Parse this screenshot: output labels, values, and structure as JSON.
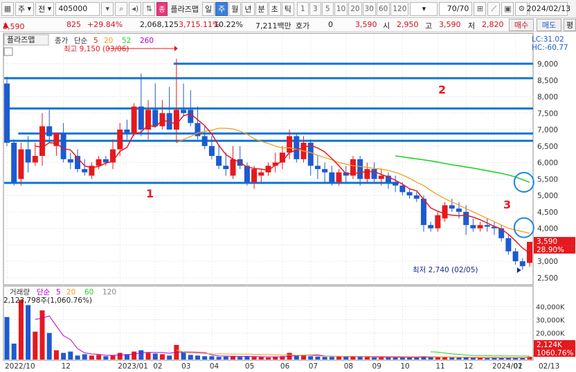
{
  "toolbar": {
    "market": "주",
    "view": "전",
    "code": "405000",
    "plugin_chip": "종",
    "plugin_name": "플라즈맵",
    "periods": [
      "일",
      "주",
      "월",
      "년",
      "분",
      "초",
      "틱"
    ],
    "active_period": "주",
    "minutes": [
      "1",
      "3",
      "5",
      "10",
      "20",
      "30",
      "60",
      "120"
    ],
    "count": "70/70",
    "date": "2024/02/13"
  },
  "quote": {
    "price": "3,590",
    "change": "825",
    "change_pct": "+29.84%",
    "volume": "2,068,125",
    "volume_ratio": "3,715.11%",
    "turnover": "10.22%",
    "amount": "7,211백만",
    "hoga_label": "호가",
    "hoga_value": "0",
    "hoga_price": "3,590",
    "open_label": "시",
    "open": "2,950",
    "high_label": "고",
    "high": "3,590",
    "low_label": "저",
    "low": "2,820",
    "buy_label": "매수",
    "sell_label": "매도",
    "eval_label": "평"
  },
  "colors": {
    "up": "#e5191e",
    "down": "#1d5ad0",
    "ma5": "#e5191e",
    "ma20": "#f29d1c",
    "ma52": "#22d127",
    "ma260": "#b100c9",
    "trendline": "#0f73d6",
    "annotation": "#e5191e",
    "circle": "#1c86e2"
  },
  "chart_data": {
    "type": "candlestick",
    "title": "플라즈맵",
    "legend": {
      "price": [
        "종가",
        "단순",
        "5",
        "20",
        "52",
        "260"
      ],
      "volume": [
        "거래량",
        "단순",
        "5",
        "20",
        "60",
        "120"
      ]
    },
    "x_labels": [
      {
        "i": 0,
        "text": "2022/10"
      },
      {
        "i": 8,
        "text": "12"
      },
      {
        "i": 16,
        "text": "2023/01"
      },
      {
        "i": 21,
        "text": "02"
      },
      {
        "i": 25,
        "text": "03"
      },
      {
        "i": 29,
        "text": "04"
      },
      {
        "i": 34,
        "text": "05"
      },
      {
        "i": 39,
        "text": "06"
      },
      {
        "i": 43,
        "text": "07"
      },
      {
        "i": 48,
        "text": "08"
      },
      {
        "i": 52,
        "text": "09"
      },
      {
        "i": 56,
        "text": "10"
      },
      {
        "i": 61,
        "text": "11"
      },
      {
        "i": 65,
        "text": "12"
      },
      {
        "i": 69,
        "text": "2024/01"
      },
      {
        "i": 72,
        "text": "02"
      }
    ],
    "x_axis_last": "02/13",
    "y_ticks": [
      2500,
      3000,
      3500,
      4000,
      4500,
      5000,
      5500,
      6000,
      6500,
      7000,
      7500,
      8000,
      8500,
      9000
    ],
    "y_tick_labels": [
      "2,500",
      "3,000",
      "3,500",
      "4,000",
      "4,500",
      "5,000",
      "5,500",
      "6,000",
      "6,500",
      "7,000",
      "7,500",
      "8,000",
      "8,500",
      "9,000"
    ],
    "ylim": [
      2350,
      9800
    ],
    "price_indicators": {
      "lc": "LC:31.02",
      "hc": "HC:-60.77",
      "last": "3,590",
      "last_pct": "28.90%"
    },
    "high_annotation": "최고 9,150 (03/06)",
    "low_annotation": "최저 2,740 (02/05)",
    "candles": [
      [
        8400,
        8600,
        6500,
        6600
      ],
      [
        6600,
        6700,
        5300,
        5400
      ],
      [
        5500,
        6600,
        5300,
        6400
      ],
      [
        6400,
        6800,
        5700,
        6000
      ],
      [
        6000,
        6600,
        5900,
        6200
      ],
      [
        6200,
        7500,
        5900,
        7100
      ],
      [
        7100,
        7600,
        6600,
        6800
      ],
      [
        6500,
        6900,
        6200,
        6900
      ],
      [
        6900,
        7200,
        6000,
        6100
      ],
      [
        6100,
        6300,
        5800,
        6000
      ],
      [
        6200,
        6400,
        5700,
        5800
      ],
      [
        5800,
        6100,
        5600,
        5700
      ],
      [
        5600,
        6000,
        5500,
        5900
      ],
      [
        5900,
        6200,
        5800,
        6100
      ],
      [
        6100,
        6200,
        5900,
        6000
      ],
      [
        6000,
        6700,
        5800,
        6400
      ],
      [
        6400,
        7200,
        6200,
        7000
      ],
      [
        7000,
        7300,
        6700,
        6900
      ],
      [
        6900,
        7800,
        6800,
        7700
      ],
      [
        7700,
        8700,
        6800,
        7000
      ],
      [
        7000,
        7900,
        6700,
        7600
      ],
      [
        7600,
        8400,
        7300,
        7100
      ],
      [
        7100,
        7900,
        7000,
        7500
      ],
      [
        7500,
        8300,
        7100,
        7000
      ],
      [
        7000,
        9150,
        6600,
        7600
      ],
      [
        7600,
        8400,
        7400,
        7500
      ],
      [
        7600,
        8200,
        7100,
        7200
      ],
      [
        7200,
        7700,
        6700,
        6800
      ],
      [
        6800,
        7100,
        6400,
        6500
      ],
      [
        6500,
        6800,
        6100,
        6200
      ],
      [
        6200,
        6500,
        5800,
        5900
      ],
      [
        5900,
        6300,
        5600,
        5800
      ],
      [
        5600,
        6500,
        5500,
        6100
      ],
      [
        6100,
        6500,
        5800,
        5900
      ],
      [
        5900,
        6000,
        5300,
        5400
      ],
      [
        5400,
        5900,
        5200,
        5800
      ],
      [
        5600,
        5800,
        5400,
        5700
      ],
      [
        5700,
        6000,
        5600,
        5900
      ],
      [
        5900,
        6300,
        5700,
        6000
      ],
      [
        6000,
        6500,
        5800,
        6300
      ],
      [
        6300,
        7000,
        6100,
        6800
      ],
      [
        6800,
        6900,
        6000,
        6100
      ],
      [
        6100,
        6800,
        6000,
        6600
      ],
      [
        6600,
        6700,
        5600,
        5900
      ],
      [
        5900,
        6200,
        5500,
        5800
      ],
      [
        5800,
        6000,
        5400,
        5700
      ],
      [
        5700,
        5900,
        5300,
        5400
      ],
      [
        5400,
        5800,
        5300,
        5700
      ],
      [
        5700,
        5900,
        5400,
        5600
      ],
      [
        5600,
        6200,
        5500,
        6100
      ],
      [
        6100,
        6200,
        5300,
        5500
      ],
      [
        5500,
        6000,
        5400,
        5800
      ],
      [
        5800,
        6000,
        5400,
        5500
      ],
      [
        5500,
        5800,
        5300,
        5600
      ],
      [
        5600,
        5700,
        5200,
        5400
      ],
      [
        5400,
        5600,
        5100,
        5300
      ],
      [
        5300,
        5400,
        5000,
        5100
      ],
      [
        5100,
        5200,
        4900,
        5000
      ],
      [
        5000,
        5100,
        4800,
        4900
      ],
      [
        4900,
        5000,
        3900,
        4100
      ],
      [
        4100,
        4200,
        3900,
        4000
      ],
      [
        4000,
        4500,
        3900,
        4400
      ],
      [
        4300,
        4800,
        4200,
        4700
      ],
      [
        4700,
        4900,
        4500,
        4600
      ],
      [
        4600,
        4800,
        4300,
        4500
      ],
      [
        4500,
        4700,
        3800,
        4100
      ],
      [
        4100,
        4300,
        3900,
        4000
      ],
      [
        4000,
        4200,
        3900,
        4100
      ],
      [
        4100,
        4300,
        3900,
        4050
      ],
      [
        4050,
        4200,
        3800,
        4000
      ],
      [
        4000,
        4100,
        3600,
        3700
      ],
      [
        3700,
        3800,
        3200,
        3300
      ],
      [
        3300,
        3400,
        2900,
        3000
      ],
      [
        3000,
        3100,
        2740,
        2850
      ],
      [
        2950,
        3590,
        2820,
        3590
      ]
    ],
    "ma5": [
      null,
      null,
      null,
      null,
      6500,
      6460,
      6600,
      6580,
      6420,
      6380,
      6140,
      5900,
      5840,
      5880,
      5980,
      6040,
      6340,
      6460,
      6880,
      6920,
      7140,
      7080,
      7280,
      7240,
      7160,
      7420,
      7480,
      7300,
      7120,
      6860,
      6520,
      6240,
      6100,
      6000,
      5860,
      5820,
      5800,
      5760,
      5920,
      6040,
      6300,
      6380,
      6460,
      6520,
      6440,
      6320,
      6120,
      5900,
      5660,
      5660,
      5700,
      5720,
      5720,
      5640,
      5560,
      5460,
      5340,
      5200,
      5140,
      4880,
      4620,
      4520,
      4440,
      4400,
      4380,
      4400,
      4340,
      4260,
      4160,
      4060,
      3980,
      3820,
      3620,
      3400,
      3250
    ],
    "ma20": [
      null,
      null,
      null,
      null,
      null,
      null,
      null,
      null,
      null,
      null,
      null,
      null,
      null,
      null,
      null,
      null,
      null,
      null,
      null,
      null,
      null,
      null,
      null,
      null,
      6600,
      6700,
      6790,
      6900,
      6940,
      6980,
      7040,
      7040,
      7020,
      6950,
      6860,
      6720,
      6640,
      6580,
      6500,
      6440,
      6450,
      6400,
      6350,
      6300,
      6220,
      6150,
      6080,
      6000,
      5950,
      5900,
      5880,
      5850,
      5820,
      5800,
      5760,
      5700,
      5620,
      5520,
      5400,
      5300,
      5150,
      5020,
      4900,
      4800,
      4700,
      4600,
      4500,
      4400,
      4300,
      4200,
      4100,
      4000,
      3950,
      3900,
      3850
    ],
    "ma52": [
      null,
      null,
      null,
      null,
      null,
      null,
      null,
      null,
      null,
      null,
      null,
      null,
      null,
      null,
      null,
      null,
      null,
      null,
      null,
      null,
      null,
      null,
      null,
      null,
      null,
      null,
      null,
      null,
      null,
      null,
      null,
      null,
      null,
      null,
      null,
      null,
      null,
      null,
      null,
      null,
      null,
      null,
      null,
      null,
      null,
      null,
      null,
      null,
      null,
      null,
      null,
      null,
      null,
      null,
      null,
      6200,
      6170,
      6140,
      6110,
      6080,
      6050,
      6010,
      5970,
      5930,
      5900,
      5860,
      5830,
      5790,
      5750,
      5710,
      5670,
      5620,
      5560,
      5480,
      5400
    ],
    "volume": {
      "ylim": [
        0,
        48000
      ],
      "y_ticks": [
        10000,
        20000,
        30000,
        40000
      ],
      "y_tick_labels": [
        "10,000K",
        "20,000K",
        "30,000K",
        "40,000K"
      ],
      "current": "2,123,798주(1,060.76%)",
      "current_short": "2,124K",
      "current_pct": "1060.76%",
      "bars": [
        32000,
        12000,
        45000,
        41000,
        21000,
        37000,
        20000,
        7000,
        5000,
        6000,
        3000,
        4000,
        3000,
        3500,
        2500,
        3000,
        5000,
        4000,
        6000,
        7000,
        5000,
        4500,
        4000,
        3000,
        11000,
        6000,
        3500,
        3000,
        2500,
        2500,
        2000,
        2200,
        2500,
        2000,
        2500,
        2000,
        1800,
        1500,
        2000,
        2500,
        5000,
        3000,
        3500,
        2500,
        2200,
        2000,
        2000,
        2500,
        2000,
        2500,
        2000,
        1800,
        1500,
        1500,
        1800,
        1500,
        1500,
        1400,
        1500,
        2500,
        2000,
        1600,
        2000,
        1500,
        1400,
        1500,
        1200,
        1100,
        1000,
        1200,
        1100,
        1400,
        1500,
        1100,
        2124
      ],
      "ma5": [
        null,
        null,
        null,
        null,
        30200,
        31200,
        32800,
        25200,
        18000,
        15000,
        8200,
        5000,
        4200,
        3900,
        3200,
        3200,
        3400,
        3600,
        4100,
        5000,
        5400,
        5300,
        5300,
        4700,
        5500,
        5700,
        5700,
        5500,
        5200,
        3500,
        2700,
        2600,
        2400,
        2300,
        2400,
        2200,
        2100,
        2000,
        2000,
        1950,
        2550,
        2800,
        3200,
        3400,
        3500,
        2650,
        2450,
        2250,
        2150,
        2200,
        2200,
        2150,
        1950,
        1850,
        1700,
        1700,
        1700,
        1550,
        1550,
        1700,
        1800,
        1800,
        1900,
        1800,
        1700,
        1650,
        1550,
        1350,
        1350,
        1300,
        1250,
        1200,
        1250,
        1260,
        1450
      ]
    }
  },
  "annotations": {
    "label_1": "1",
    "label_2": "2",
    "label_3": "3",
    "hlines": [
      {
        "name": "resistance-1",
        "value": 9000,
        "start": 24,
        "end": 74
      },
      {
        "name": "resistance-2",
        "value": 8560,
        "start": 0,
        "end": 74
      },
      {
        "name": "resistance-3",
        "value": 7640,
        "start": 0,
        "end": 74
      },
      {
        "name": "band-top",
        "value": 6880,
        "start": 2,
        "end": 74
      },
      {
        "name": "band-bottom",
        "value": 6660,
        "start": 0,
        "end": 74
      },
      {
        "name": "support-1",
        "value": 5380,
        "start": 0,
        "end": 55
      }
    ],
    "circles": [
      {
        "name": "ma52-circle",
        "i": 73.2,
        "value": 5400
      },
      {
        "name": "ma20-circle",
        "i": 73.2,
        "value": 4020
      }
    ]
  }
}
